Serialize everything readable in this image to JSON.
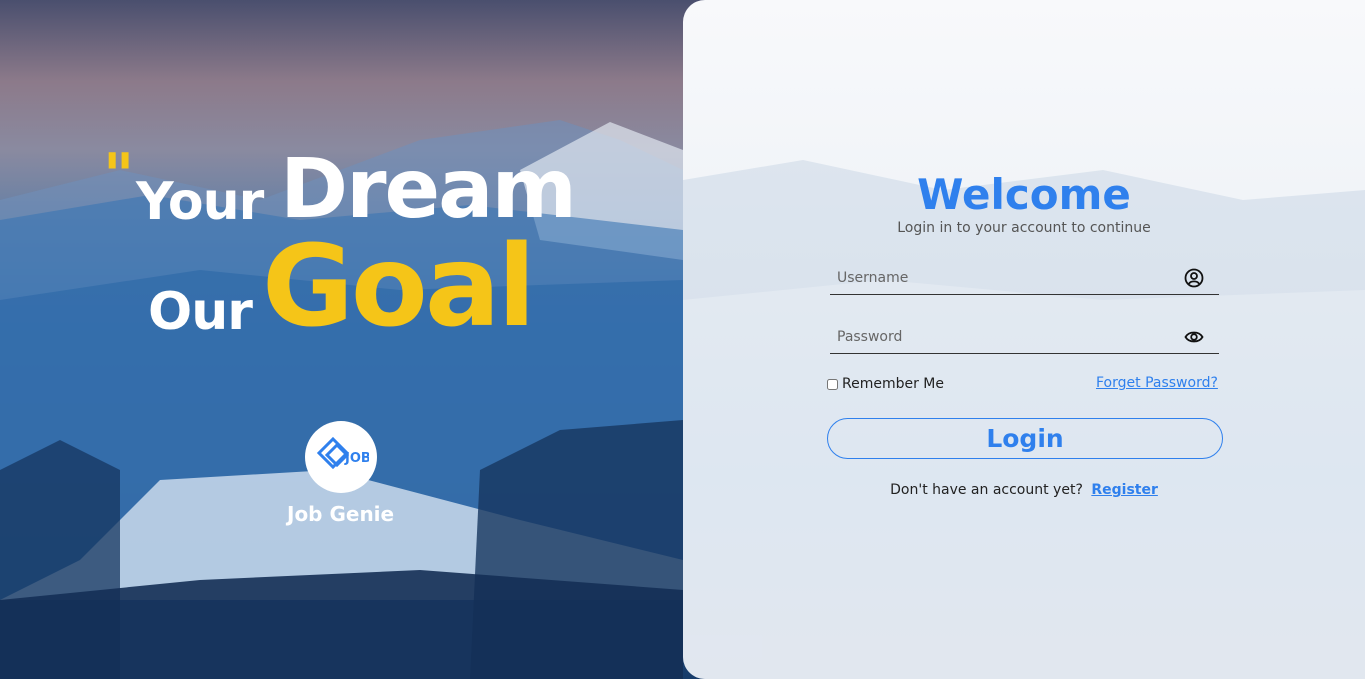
{
  "hero": {
    "quote_mark": "\"",
    "word_your": "Your",
    "word_dream": "Dream",
    "word_our": "Our",
    "word_goal": "Goal",
    "logo_text": "JOB",
    "brand_name": "Job Genie"
  },
  "login": {
    "title": "Welcome",
    "subtitle": "Login in to your account to continue",
    "username_placeholder": "Username",
    "password_placeholder": "Password",
    "remember_label": "Remember Me",
    "forgot_label": "Forget Password?",
    "login_label": "Login",
    "signup_prompt": "Don't have an account yet?",
    "register_label": "Register"
  },
  "icons": {
    "username": "user-circle-icon",
    "password": "eye-icon",
    "logo": "job-logo-icon"
  },
  "colors": {
    "accent_blue": "#2f80ed",
    "accent_yellow": "#f5c518"
  }
}
